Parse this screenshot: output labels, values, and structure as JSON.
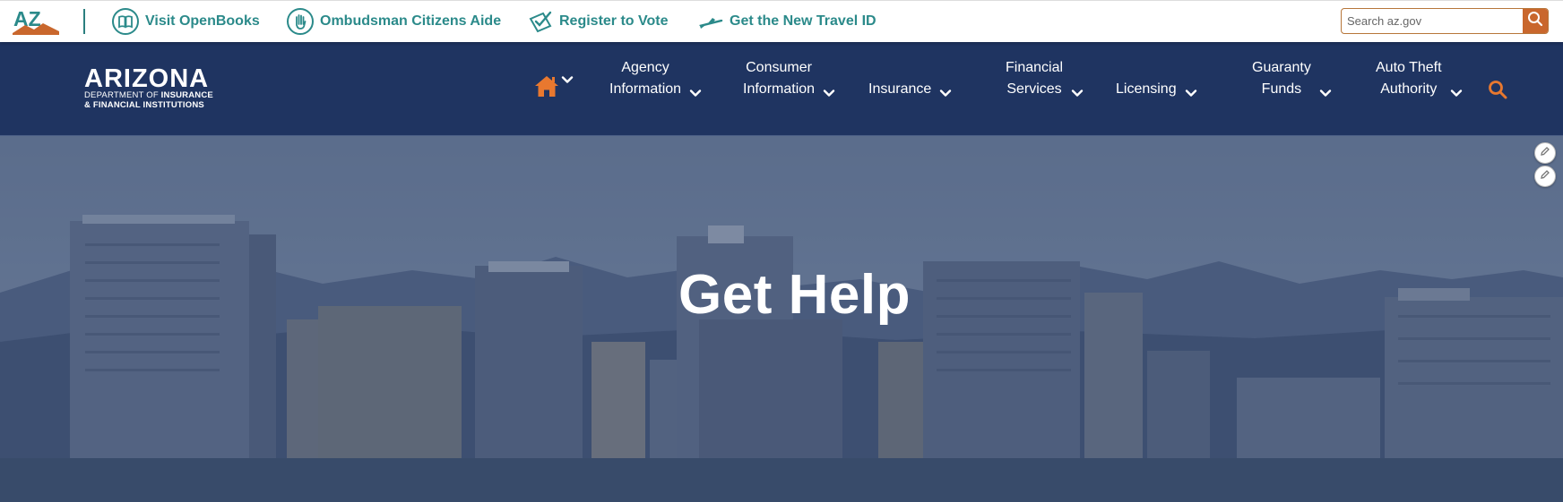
{
  "utility_bar": {
    "logo_text": "AZ",
    "links": [
      {
        "label": "Visit OpenBooks",
        "icon": "book-icon"
      },
      {
        "label": "Ombudsman Citizens Aide",
        "icon": "hand-icon"
      },
      {
        "label": "Register to Vote",
        "icon": "ballot-check-icon"
      },
      {
        "label": "Get the New Travel ID",
        "icon": "airplane-icon"
      }
    ],
    "search": {
      "placeholder": "Search az.gov",
      "icon": "search-icon"
    }
  },
  "brand": {
    "name": "ARIZONA",
    "sub_line1_prefix": "DEPARTMENT OF ",
    "sub_line1_bold": "INSURANCE",
    "sub_line2": "& FINANCIAL INSTITUTIONS"
  },
  "nav": {
    "home_icon": "home-icon",
    "items": [
      {
        "line1": "Agency",
        "line2": "Information"
      },
      {
        "line1": "Consumer",
        "line2": "Information"
      },
      {
        "line1": "",
        "line2": "Insurance"
      },
      {
        "line1": "Financial",
        "line2": "Services"
      },
      {
        "line1": "",
        "line2": "Licensing"
      },
      {
        "line1": "Guaranty",
        "line2": "Funds"
      },
      {
        "line1": "Auto Theft",
        "line2": "Authority"
      }
    ],
    "search_icon": "search-icon"
  },
  "hero": {
    "title": "Get Help"
  },
  "colors": {
    "utility_link": "#2b8a8a",
    "nav_bg": "#1f3461",
    "accent_orange": "#e8782f"
  }
}
